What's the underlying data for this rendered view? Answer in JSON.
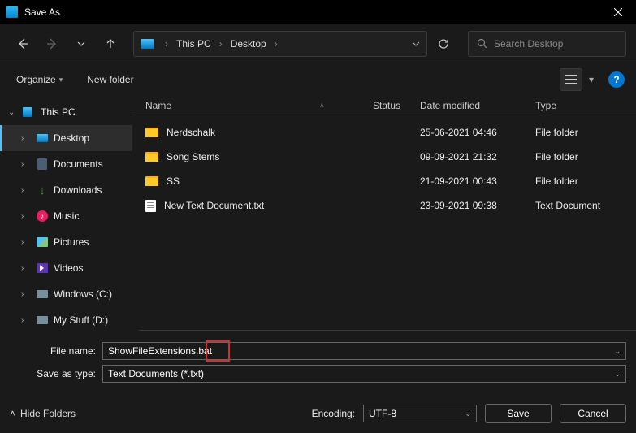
{
  "title": "Save As",
  "breadcrumbs": [
    "This PC",
    "Desktop"
  ],
  "search": {
    "placeholder": "Search Desktop"
  },
  "toolbar": {
    "organize": "Organize",
    "new_folder": "New folder"
  },
  "sidebar": {
    "root": "This PC",
    "items": [
      "Desktop",
      "Documents",
      "Downloads",
      "Music",
      "Pictures",
      "Videos",
      "Windows (C:)",
      "My Stuff (D:)"
    ]
  },
  "columns": {
    "name": "Name",
    "status": "Status",
    "date": "Date modified",
    "type": "Type"
  },
  "files": [
    {
      "name": "Nerdschalk",
      "date": "25-06-2021 04:46",
      "type": "File folder",
      "kind": "folder"
    },
    {
      "name": "Song Stems",
      "date": "09-09-2021 21:32",
      "type": "File folder",
      "kind": "folder"
    },
    {
      "name": "SS",
      "date": "21-09-2021 00:43",
      "type": "File folder",
      "kind": "folder"
    },
    {
      "name": "New Text Document.txt",
      "date": "23-09-2021 09:38",
      "type": "Text Document",
      "kind": "txt"
    }
  ],
  "filename_label": "File name:",
  "filename_value": "ShowFileExtensions.bat",
  "save_type_label": "Save as type:",
  "save_type_value": "Text Documents (*.txt)",
  "hide_folders": "Hide Folders",
  "encoding_label": "Encoding:",
  "encoding_value": "UTF-8",
  "save": "Save",
  "cancel": "Cancel"
}
